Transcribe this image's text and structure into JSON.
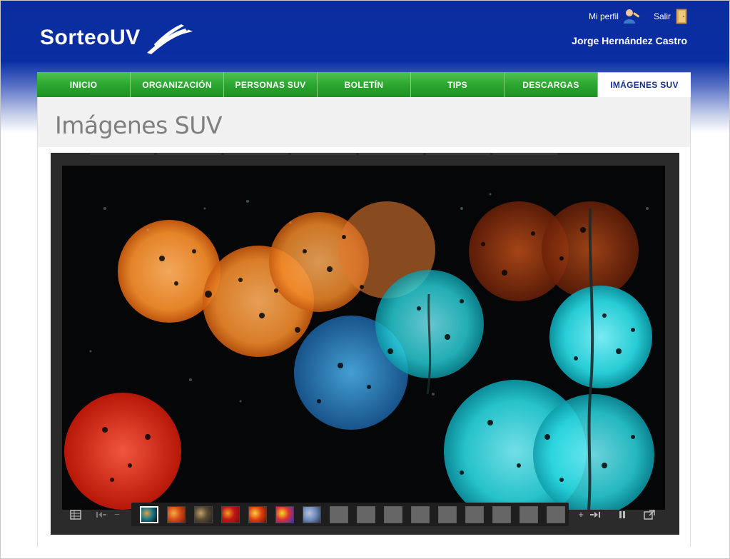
{
  "header": {
    "logo_text": "SorteoUV",
    "profile_link": "Mi perfil",
    "logout_link": "Salir",
    "user_name": "Jorge Hernández Castro"
  },
  "nav": {
    "items": [
      {
        "label": "INICIO",
        "active": false
      },
      {
        "label": "ORGANIZACIÓN",
        "active": false
      },
      {
        "label": "PERSONAS SUV",
        "active": false
      },
      {
        "label": "BOLETÍN",
        "active": false
      },
      {
        "label": "TIPS",
        "active": false
      },
      {
        "label": "DESCARGAS",
        "active": false
      },
      {
        "label": "IMÁGENES SUV",
        "active": true
      }
    ]
  },
  "page": {
    "title": "Imágenes SUV"
  },
  "gallery": {
    "current_image": 1,
    "thumbnails": [
      {
        "kind": "image",
        "colors": [
          "#1b7a8e",
          "#e0a040",
          "#0b0b0b"
        ]
      },
      {
        "kind": "image",
        "colors": [
          "#d84a1a",
          "#f0b040",
          "#7a1a08"
        ]
      },
      {
        "kind": "image",
        "colors": [
          "#5a4a30",
          "#c0a070",
          "#202020"
        ]
      },
      {
        "kind": "image",
        "colors": [
          "#c01818",
          "#f0a020",
          "#800808"
        ]
      },
      {
        "kind": "image",
        "colors": [
          "#e04010",
          "#f8d040",
          "#601008"
        ]
      },
      {
        "kind": "image",
        "colors": [
          "#e03030",
          "#f0e020",
          "#3030c0"
        ]
      },
      {
        "kind": "image",
        "colors": [
          "#7090c0",
          "#c0c0e0",
          "#303050"
        ]
      },
      {
        "kind": "empty"
      },
      {
        "kind": "empty"
      },
      {
        "kind": "empty"
      },
      {
        "kind": "empty"
      },
      {
        "kind": "empty"
      },
      {
        "kind": "empty"
      },
      {
        "kind": "empty"
      },
      {
        "kind": "empty"
      },
      {
        "kind": "empty"
      }
    ],
    "colors": {
      "frame": "#2b2b2b",
      "strip": "#1e1e1e"
    }
  },
  "colors": {
    "header_blue": "#0a2fa3",
    "nav_green": "#2aa52e",
    "active_text": "#17308e",
    "title_gray": "#7f7f7f"
  }
}
